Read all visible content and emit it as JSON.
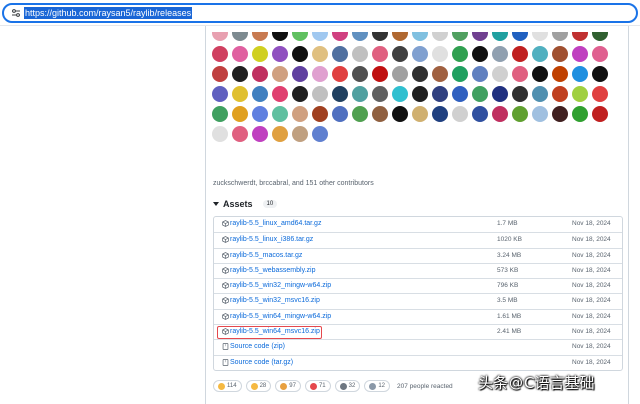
{
  "browser": {
    "url": "https://github.com/raysan5/raylib/releases"
  },
  "contributors_text": "zuckschwerdt, brccabral, and 151 other contributors",
  "avatar_colors": [
    [
      "#e8a0b0",
      "#7d8a90",
      "#c87a50",
      "#101010",
      "#60c060",
      "#a0c8f0",
      "#d04080",
      "#6090c0",
      "#333",
      "#b06830",
      "#80c0e0",
      "#d0d0d0",
      "#50a060",
      "#704090",
      "#20a0a0",
      "#2060c0",
      "#e0e0e0",
      "#a0a0a0",
      "#c03030",
      "#306030"
    ],
    [
      "#d04060",
      "#e060a0",
      "#d0d020",
      "#9050c0",
      "#101010",
      "#e0c080",
      "#5070a0",
      "#c0c0c0",
      "#e06080",
      "#404040",
      "#80a0d0",
      "#e0e0e0",
      "#30a050",
      "#101010",
      "#90a0b0",
      "#c02020",
      "#50b0c0",
      "#a05030",
      "#c040c0",
      "#e06090"
    ],
    [
      "#c04040",
      "#202020",
      "#c03060",
      "#d0a080",
      "#6040a0",
      "#e0a0d0",
      "#e04040",
      "#505050",
      "#c01010",
      "#a0a0a0",
      "#303030",
      "#a06040",
      "#20a060",
      "#6080c0",
      "#d0d0d0",
      "#e06080",
      "#101010",
      "#c04000",
      "#2090e0",
      "#101010"
    ],
    [
      "#6060c0",
      "#e0c030",
      "#4080c0",
      "#e04070",
      "#202020",
      "#c0c0c0",
      "#204060",
      "#50a0a0",
      "#606060",
      "#30c0d0",
      "#202020",
      "#304080",
      "#3060c0",
      "#40a060",
      "#203080",
      "#303030",
      "#5090b0",
      "#c04020",
      "#a0d040",
      "#e04040"
    ],
    [
      "#40a060",
      "#e0a020",
      "#6080e0",
      "#60c0a0",
      "#d0a080",
      "#a04020",
      "#5070c0",
      "#50a050",
      "#906040",
      "#101010",
      "#d0b070",
      "#204080",
      "#d0d0d0",
      "#3050a0",
      "#c03060",
      "#60a030",
      "#a0c0e0",
      "#402020",
      "#30a030",
      "#c02020"
    ],
    [
      "#e0e0e0",
      "#e06080",
      "#c040c0",
      "#e0a040",
      "#c0a080",
      "#6080d0"
    ]
  ],
  "assets": {
    "title": "Assets",
    "count": "10",
    "items": [
      {
        "name": "raylib-5.5_linux_amd64.tar.gz",
        "size": "1.7 MB",
        "date": "Nov 18, 2024"
      },
      {
        "name": "raylib-5.5_linux_i386.tar.gz",
        "size": "1020 KB",
        "date": "Nov 18, 2024"
      },
      {
        "name": "raylib-5.5_macos.tar.gz",
        "size": "3.24 MB",
        "date": "Nov 18, 2024"
      },
      {
        "name": "raylib-5.5_webassembly.zip",
        "size": "573 KB",
        "date": "Nov 18, 2024"
      },
      {
        "name": "raylib-5.5_win32_mingw-w64.zip",
        "size": "796 KB",
        "date": "Nov 18, 2024"
      },
      {
        "name": "raylib-5.5_win32_msvc16.zip",
        "size": "3.5 MB",
        "date": "Nov 18, 2024"
      },
      {
        "name": "raylib-5.5_win64_mingw-w64.zip",
        "size": "1.61 MB",
        "date": "Nov 18, 2024"
      },
      {
        "name": "raylib-5.5_win64_msvc16.zip",
        "size": "2.41 MB",
        "date": "Nov 18, 2024",
        "highlighted": true
      }
    ],
    "source": [
      {
        "label": "Source code",
        "kind": "(zip)",
        "date": "Nov 18, 2024"
      },
      {
        "label": "Source code",
        "kind": "(tar.gz)",
        "date": "Nov 18, 2024"
      }
    ]
  },
  "reactions": [
    {
      "emoji": "thumbs-up",
      "count": "114",
      "color": "#f5b942"
    },
    {
      "emoji": "smile",
      "count": "28",
      "color": "#f5b942"
    },
    {
      "emoji": "tada",
      "count": "97",
      "color": "#e8a040"
    },
    {
      "emoji": "heart",
      "count": "71",
      "color": "#e5484d"
    },
    {
      "emoji": "rocket",
      "count": "32",
      "color": "#6e7781"
    },
    {
      "emoji": "eyes",
      "count": "12",
      "color": "#8a98a8"
    }
  ],
  "reactions_text": "207 people reacted",
  "watermark": {
    "prefix": "头条",
    "suffix": "C语言基础"
  }
}
